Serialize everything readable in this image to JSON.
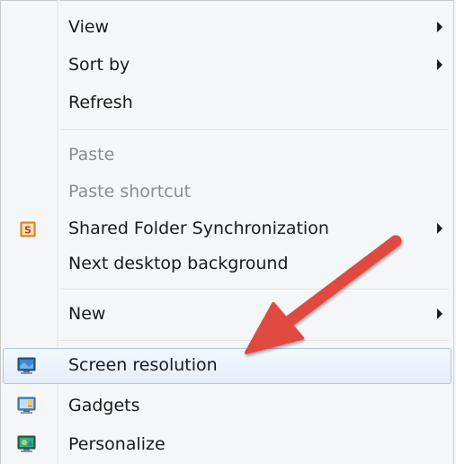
{
  "menu": {
    "items": [
      {
        "label": "View",
        "submenu": true,
        "disabled": false
      },
      {
        "label": "Sort by",
        "submenu": true,
        "disabled": false
      },
      {
        "label": "Refresh",
        "submenu": false,
        "disabled": false
      },
      {
        "label": "Paste",
        "submenu": false,
        "disabled": true
      },
      {
        "label": "Paste shortcut",
        "submenu": false,
        "disabled": true
      },
      {
        "label": "Shared Folder Synchronization",
        "submenu": true,
        "disabled": false,
        "icon": "shared-folder-sync-icon"
      },
      {
        "label": "Next desktop background",
        "submenu": false,
        "disabled": false
      },
      {
        "label": "New",
        "submenu": true,
        "disabled": false
      },
      {
        "label": "Screen resolution",
        "submenu": false,
        "disabled": false,
        "icon": "monitor-icon",
        "highlighted": true
      },
      {
        "label": "Gadgets",
        "submenu": false,
        "disabled": false,
        "icon": "gadgets-icon"
      },
      {
        "label": "Personalize",
        "submenu": false,
        "disabled": false,
        "icon": "personalize-icon"
      }
    ],
    "icon_letter_shared": "S"
  },
  "colors": {
    "annotation_arrow": "#e04a3f",
    "highlight_border": "#a8c8ea",
    "disabled_text": "#8d8d8d"
  }
}
